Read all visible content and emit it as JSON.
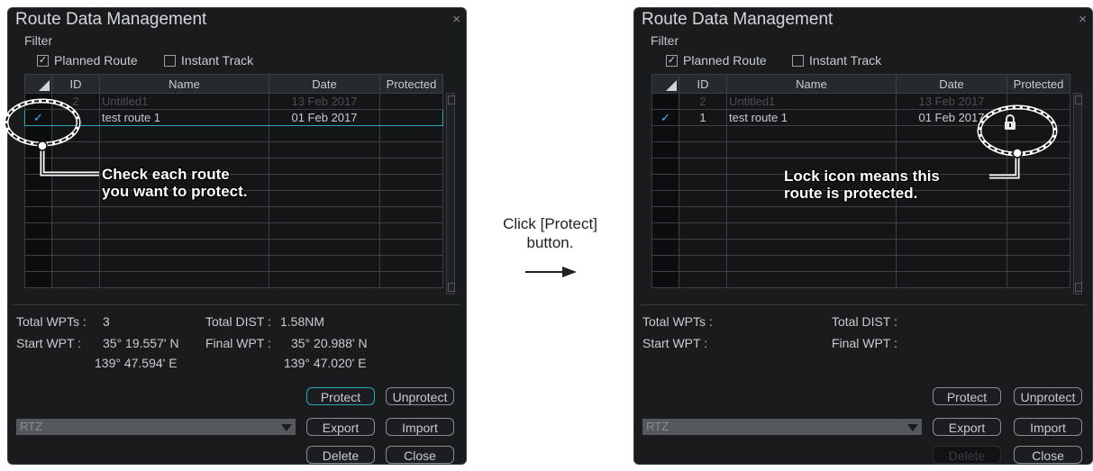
{
  "left": {
    "title": "Route Data Management",
    "close_glyph": "×",
    "filter_label": "Filter",
    "planned_route_label": "Planned Route",
    "instant_track_label": "Instant Track",
    "columns": [
      "",
      "ID",
      "Name",
      "Date",
      "Protected"
    ],
    "rows": [
      {
        "check": "",
        "id": "2",
        "name": "Untitled1",
        "date": "13 Feb 2017",
        "protected": ""
      },
      {
        "check": "✓",
        "id": "",
        "name": "test route 1",
        "date": "01 Feb 2017",
        "protected": ""
      }
    ],
    "total_wpts_label": "Total WPTs :",
    "total_wpts_value": "3",
    "total_dist_label": "Total DIST :",
    "total_dist_value": "1.58NM",
    "start_wpt_label": "Start WPT :",
    "start_wpt_lat": "35° 19.557' N",
    "start_wpt_lon": "139° 47.594' E",
    "final_wpt_label": "Final WPT :",
    "final_wpt_lat": "35° 20.988' N",
    "final_wpt_lon": "139° 47.020' E",
    "format_value": "RTZ",
    "buttons": {
      "protect": "Protect",
      "unprotect": "Unprotect",
      "export": "Export",
      "import": "Import",
      "delete": "Delete",
      "close": "Close"
    },
    "annotation": [
      "Check each route",
      "you want to protect."
    ]
  },
  "middle": {
    "instruction_line1": "Click [Protect]",
    "instruction_line2": "button."
  },
  "right": {
    "title": "Route Data Management",
    "close_glyph": "×",
    "filter_label": "Filter",
    "planned_route_label": "Planned Route",
    "instant_track_label": "Instant Track",
    "columns": [
      "",
      "ID",
      "Name",
      "Date",
      "Protected"
    ],
    "rows": [
      {
        "check": "",
        "id": "2",
        "name": "Untitled1",
        "date": "13 Feb 2017",
        "protected": ""
      },
      {
        "check": "✓",
        "id": "1",
        "name": "test route 1",
        "date": "01 Feb 2017",
        "protected": "lock-icon"
      }
    ],
    "total_wpts_label": "Total WPTs :",
    "total_dist_label": "Total DIST :",
    "start_wpt_label": "Start WPT :",
    "final_wpt_label": "Final WPT :",
    "format_value": "RTZ",
    "buttons": {
      "protect": "Protect",
      "unprotect": "Unprotect",
      "export": "Export",
      "import": "Import",
      "delete": "Delete",
      "close": "Close"
    },
    "annotation": [
      "Lock icon means this",
      "route is protected."
    ]
  },
  "colors": {
    "accent": "#2aa6b8",
    "check": "#3ab8ff",
    "panel": "#1a1b1d"
  }
}
